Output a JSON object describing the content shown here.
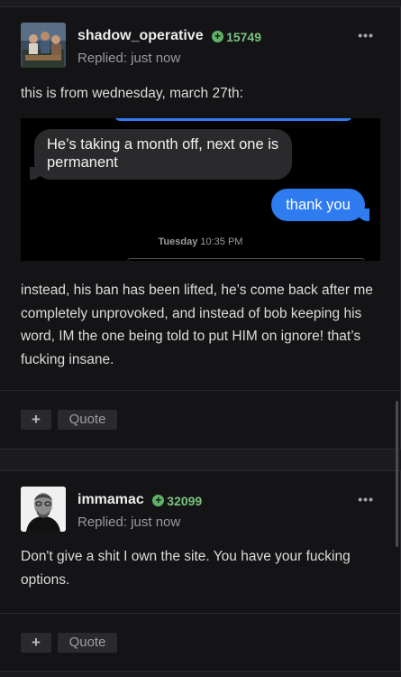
{
  "posts": [
    {
      "username": "shadow_operative",
      "reputation": "15749",
      "replied": "Replied: just now",
      "intro": "this is from wednesday, march 27th:",
      "screenshot": {
        "grey_message": "He’s taking a month off, next one is permanent",
        "blue_message": "thank you",
        "timestamp_day": "Tuesday",
        "timestamp_time": "10:35 PM"
      },
      "body": "instead, his ban has been lifted, he’s come back after me completely unprovoked, and instead of bob keeping his word, IM the one being told to put HIM on ignore! that’s fucking insane."
    },
    {
      "username": "immamac",
      "reputation": "32099",
      "replied": "Replied: just now",
      "body": "Don't give a shit I own the site. You have your fucking options."
    }
  ],
  "actions": {
    "plus_label": "+",
    "quote_label": "Quote",
    "more_label": "•••"
  },
  "colors": {
    "reputation": "#79c27f",
    "imessage_blue": "#2e7cf0",
    "imessage_grey": "#2a2a2c"
  },
  "icons": {
    "reputation": "plus-circle-icon",
    "more": "ellipsis-icon"
  }
}
